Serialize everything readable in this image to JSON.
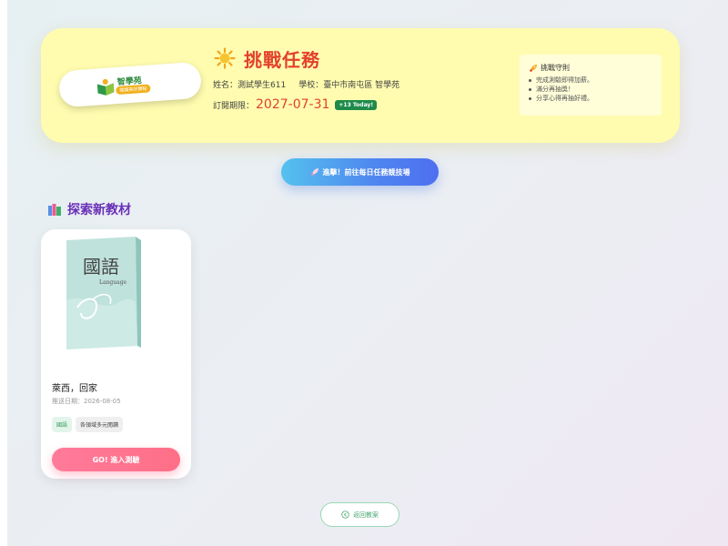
{
  "hero": {
    "logo_name": "智學苑",
    "logo_tagline": "閱讀美好課程",
    "title": "挑戰任務",
    "student_label": "姓名：",
    "student_name": "測試學生611",
    "school_label": "學校：",
    "school_name": "臺中市南屯區 智學苑",
    "expiry_label": "訂閱期限：",
    "expiry_date": "2027-07-31",
    "today_badge": "+13 Today!",
    "rules": {
      "title": "挑戰守則",
      "items": [
        "完成測驗即得加薪。",
        "滿分再抽獎！",
        "分享心得再抽好禮。"
      ]
    }
  },
  "cta": {
    "label": "進擊！前往每日任務競技場"
  },
  "section": {
    "title": "探索新教材"
  },
  "materials": [
    {
      "cover_title": "國語",
      "cover_subtitle": "Language",
      "title": "萊西，回家",
      "date_label": "推送日期：",
      "date": "2026-08-05",
      "tags": [
        "國語",
        "各領域多元閱讀"
      ],
      "go_label": "GO! 進入測驗"
    }
  ],
  "footer": {
    "back_label": "返回教案"
  },
  "colors": {
    "hero_bg": "#fffcaf",
    "title_red": "#e3412c",
    "section_purple": "#6a2fb8",
    "go_pink": "#ff6f87",
    "badge_green": "#1e8a4a"
  }
}
